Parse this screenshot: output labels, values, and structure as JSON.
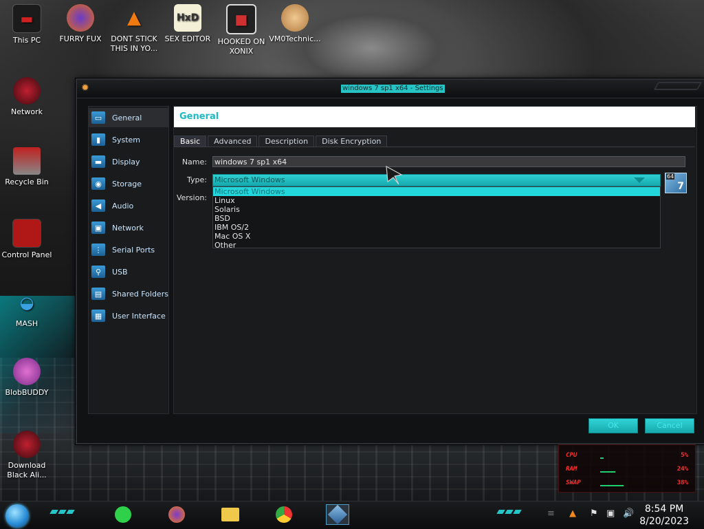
{
  "desktop": {
    "icons": [
      {
        "label": "This PC"
      },
      {
        "label": "FURRY FUX"
      },
      {
        "label": "DONT STICK THIS IN YO..."
      },
      {
        "label": "SEX EDITOR"
      },
      {
        "label": "HOOKED ON XONIX"
      },
      {
        "label": "VM0Technic..."
      },
      {
        "label": "Network"
      },
      {
        "label": "Recycle Bin"
      },
      {
        "label": "Control Panel"
      },
      {
        "label": "MASH"
      },
      {
        "label": "BlobBUDDY"
      },
      {
        "label": "Download Black Ali..."
      }
    ]
  },
  "dialog": {
    "title": "windows 7 sp1 x64 - Settings",
    "sidebar": [
      {
        "label": "General",
        "active": true
      },
      {
        "label": "System"
      },
      {
        "label": "Display"
      },
      {
        "label": "Storage"
      },
      {
        "label": "Audio"
      },
      {
        "label": "Network"
      },
      {
        "label": "Serial Ports"
      },
      {
        "label": "USB"
      },
      {
        "label": "Shared Folders"
      },
      {
        "label": "User Interface"
      }
    ],
    "header": "General",
    "tabs": [
      {
        "label": "Basic",
        "active": true
      },
      {
        "label": "Advanced"
      },
      {
        "label": "Description"
      },
      {
        "label": "Disk Encryption"
      }
    ],
    "fields": {
      "name_label": "Name:",
      "name_value": "windows 7 sp1 x64",
      "type_label": "Type:",
      "type_value": "Microsoft Windows",
      "version_label": "Version:"
    },
    "type_options": [
      "Microsoft Windows",
      "Linux",
      "Solaris",
      "BSD",
      "IBM OS/2",
      "Mac OS X",
      "Other"
    ],
    "os_badge": {
      "bits": "64",
      "version": "7"
    },
    "buttons": {
      "ok": "OK",
      "cancel": "Cancel"
    }
  },
  "sysmon": {
    "rows": [
      {
        "label": "CPU",
        "value": "5%",
        "level": 0.05
      },
      {
        "label": "RAM",
        "value": "24%",
        "level": 0.24
      },
      {
        "label": "SWAP",
        "value": "38%",
        "level": 0.38
      }
    ]
  },
  "taskbar": {
    "clock_time": "8:54 PM",
    "clock_date": "8/20/2023"
  },
  "colors": {
    "accent": "#27c4c6",
    "header_text": "#1fb7c3",
    "monitor_text": "#ff3030"
  }
}
